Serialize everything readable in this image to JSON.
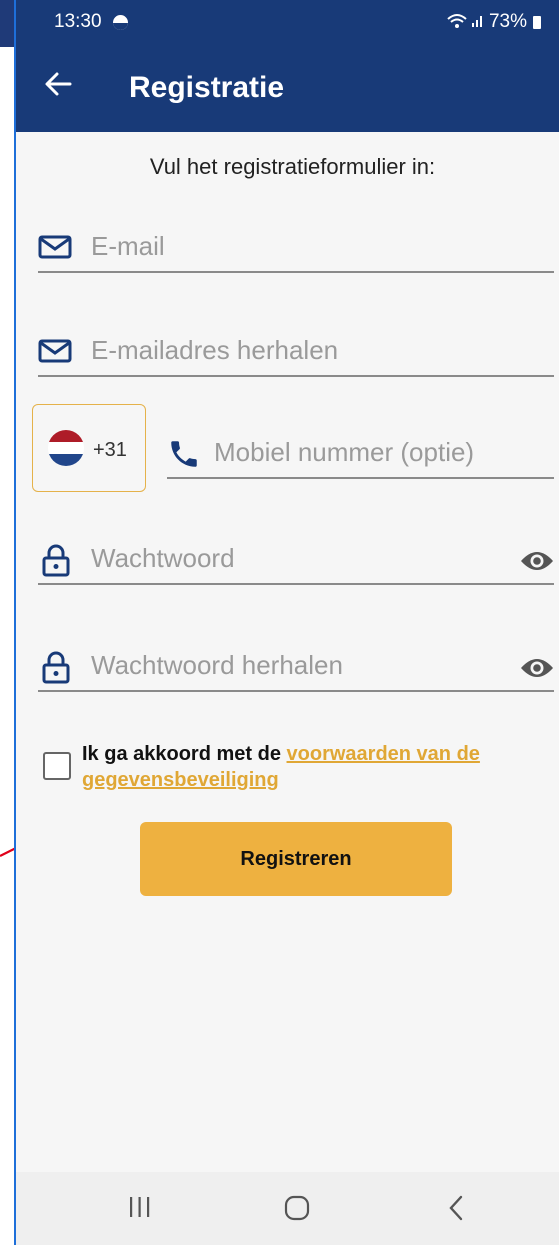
{
  "status_bar": {
    "time": "13:30",
    "battery": "73%",
    "icons": [
      "moon-icon",
      "wifi-icon",
      "signal-icon",
      "battery-icon"
    ]
  },
  "app_bar": {
    "back_icon": "arrow-left-icon",
    "title": "Registratie"
  },
  "form": {
    "instruction": "Vul het registratieformulier in:",
    "email": {
      "placeholder": "E-mail",
      "icon": "mail-icon"
    },
    "email_repeat": {
      "placeholder": "E-mailadres herhalen",
      "icon": "mail-icon"
    },
    "country": {
      "flag": "netherlands-flag-icon",
      "dial_code": "+31"
    },
    "mobile": {
      "placeholder": "Mobiel nummer (optie)",
      "icon": "phone-icon"
    },
    "password": {
      "placeholder": "Wachtwoord",
      "icon": "lock-icon",
      "toggle_icon": "eye-icon"
    },
    "password_repeat": {
      "placeholder": "Wachtwoord herhalen",
      "icon": "lock-icon",
      "toggle_icon": "eye-icon"
    },
    "consent": {
      "checked": false,
      "text": "Ik ga akkoord met de ",
      "link_text": "voorwaarden van de gegevensbeveiliging"
    },
    "submit_label": "Registreren"
  },
  "nav_bar": {
    "icons": [
      "recent-apps-icon",
      "home-icon",
      "back-nav-icon"
    ]
  },
  "colors": {
    "primary": "#183a78",
    "accent": "#eeb140",
    "link": "#e0a735",
    "annotation_arrow": "#e0001a"
  }
}
